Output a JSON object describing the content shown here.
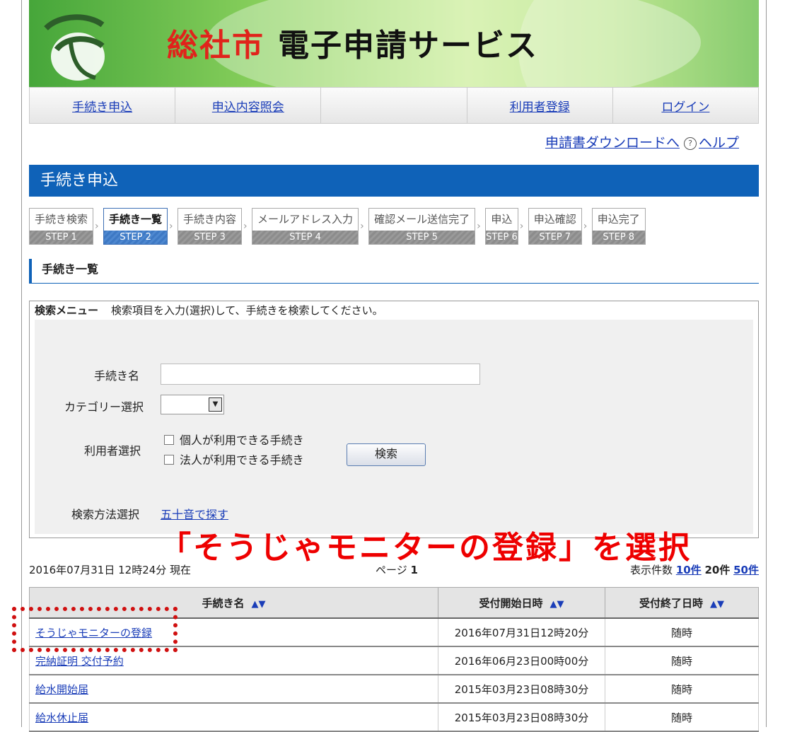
{
  "header": {
    "city": "総社市",
    "service": "電子申請サービス"
  },
  "nav": {
    "items": [
      "手続き申込",
      "申込内容照会",
      "",
      "利用者登録",
      "ログイン"
    ]
  },
  "utility": {
    "download": "申請書ダウンロードへ",
    "help": "ヘルプ"
  },
  "page_title": "手続き申込",
  "steps": [
    {
      "label": "手続き検索",
      "step": "STEP 1",
      "active": false
    },
    {
      "label": "手続き一覧",
      "step": "STEP 2",
      "active": true
    },
    {
      "label": "手続き内容",
      "step": "STEP 3",
      "active": false
    },
    {
      "label": "メールアドレス入力",
      "step": "STEP 4",
      "active": false
    },
    {
      "label": "確認メール送信完了",
      "step": "STEP 5",
      "active": false
    },
    {
      "label": "申込",
      "step": "STEP 6",
      "active": false
    },
    {
      "label": "申込確認",
      "step": "STEP 7",
      "active": false
    },
    {
      "label": "申込完了",
      "step": "STEP 8",
      "active": false
    }
  ],
  "section_title": "手続き一覧",
  "search": {
    "menu_label": "検索メニュー",
    "menu_desc": "検索項目を入力(選択)して、手続きを検索してください。",
    "name_label": "手続き名",
    "name_value": "",
    "category_label": "カテゴリー選択",
    "category_value": "",
    "user_label": "利用者選択",
    "opt_personal": "個人が利用できる手続き",
    "opt_corporate": "法人が利用できる手続き",
    "search_button": "検索",
    "method_label": "検索方法選択",
    "method_link": "五十音で探す"
  },
  "annotation": "「そうじゃモニターの登録」を選択",
  "list_info": {
    "timestamp": "2016年07月31日 12時24分 現在",
    "page_label": "ページ",
    "page_num": "1",
    "count_label": "表示件数",
    "count_10": "10件",
    "count_20": "20件",
    "count_50": "50件"
  },
  "table": {
    "headers": [
      "手続き名",
      "受付開始日時",
      "受付終了日時"
    ],
    "sort_glyph": "▲▼",
    "rows": [
      [
        "そうじゃモニターの登録",
        "2016年07月31日12時20分",
        "随時"
      ],
      [
        "完納証明 交付予約",
        "2016年06月23日00時00分",
        "随時"
      ],
      [
        "給水開始届",
        "2015年03月23日08時30分",
        "随時"
      ],
      [
        "給水休止届",
        "2015年03月23日08時30分",
        "随時"
      ]
    ]
  },
  "colors": {
    "title_bar": "#0f62b8",
    "city": "#e0231b",
    "annotation": "#e00000",
    "link": "#1a3db8"
  }
}
